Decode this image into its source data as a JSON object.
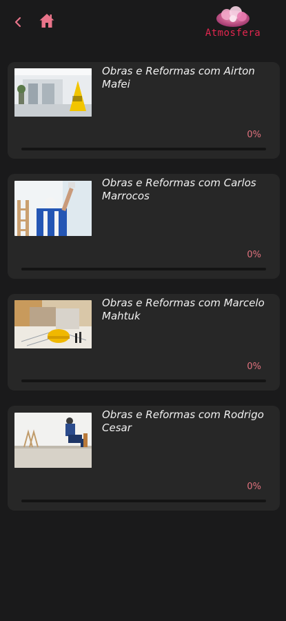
{
  "header": {
    "brand": "Atmosfera",
    "accent_color": "#e2264f",
    "home_icon_color": "#e9748a"
  },
  "courses": [
    {
      "title": "Obras e Reformas com Airton Mafei",
      "progress_label": "0%",
      "progress": 0,
      "thumbnail": "cleaning-sign-photo"
    },
    {
      "title": "Obras e Reformas com Carlos Marrocos",
      "progress_label": "0%",
      "progress": 0,
      "thumbnail": "painter-photo"
    },
    {
      "title": "Obras e Reformas com Marcelo Mahtuk",
      "progress_label": "0%",
      "progress": 0,
      "thumbnail": "blueprint-helmet-photo"
    },
    {
      "title": "Obras e Reformas com Rodrigo Cesar",
      "progress_label": "0%",
      "progress": 0,
      "thumbnail": "floor-worker-photo"
    }
  ],
  "colors": {
    "background": "#1a1a1b",
    "card": "#272727",
    "progress_accent": "#e0727e"
  }
}
